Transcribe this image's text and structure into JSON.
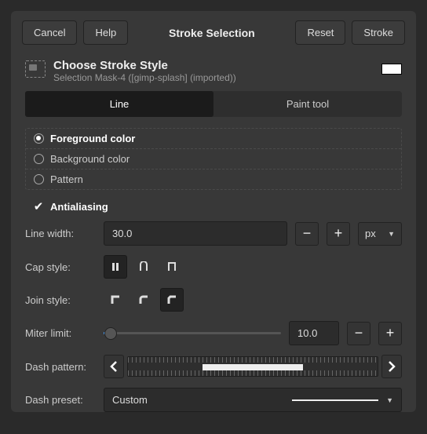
{
  "buttons": {
    "cancel": "Cancel",
    "help": "Help",
    "reset": "Reset",
    "stroke": "Stroke"
  },
  "header_title": "Stroke Selection",
  "title": "Choose Stroke Style",
  "subtitle": "Selection Mask-4 ([gimp-splash] (imported))",
  "tabs": {
    "line": "Line",
    "paint": "Paint tool"
  },
  "radios": {
    "fg": "Foreground color",
    "bg": "Background color",
    "pattern": "Pattern"
  },
  "antialias_label": "Antialiasing",
  "line_width": {
    "label": "Line width:",
    "value": "30.0",
    "unit": "px"
  },
  "cap_style_label": "Cap style:",
  "join_style_label": "Join style:",
  "miter": {
    "label": "Miter limit:",
    "value": "10.0"
  },
  "dash_pattern_label": "Dash pattern:",
  "dash_preset": {
    "label": "Dash preset:",
    "value": "Custom"
  }
}
